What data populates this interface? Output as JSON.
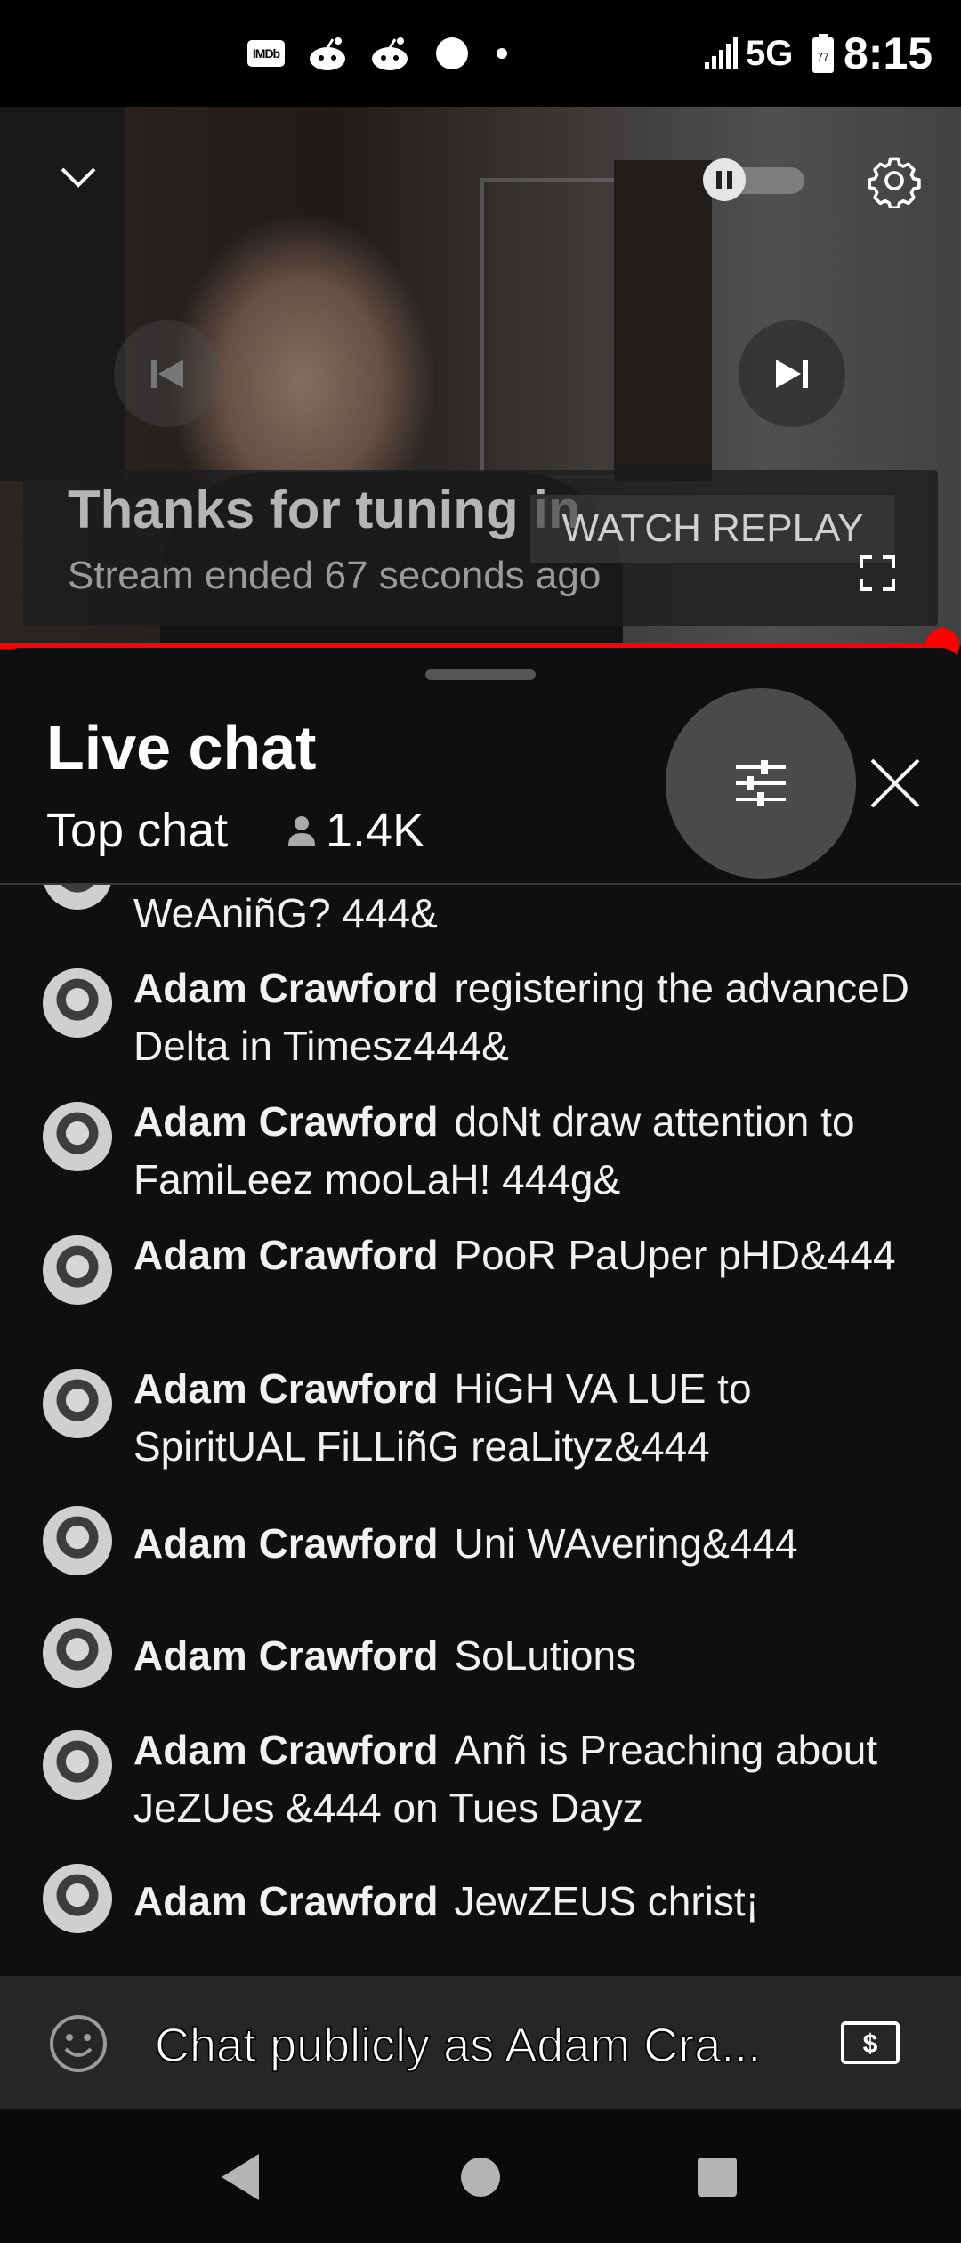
{
  "status_bar": {
    "app_icons": [
      "imdb-icon",
      "reddit-icon",
      "reddit-icon",
      "circle-dot-icon",
      "small-dot-icon"
    ],
    "imdb_label": "IMDb",
    "network": "5G",
    "battery_level": "77",
    "time": "8:15"
  },
  "player": {
    "ended_title": "Thanks for tuning in",
    "ended_subtitle": "Stream ended 67 seconds ago",
    "watch_replay_label": "WATCH REPLAY",
    "progress": 1.0
  },
  "chat": {
    "title": "Live chat",
    "mode": "Top chat",
    "viewer_count": "1.4K",
    "messages": [
      {
        "author": "",
        "text": "WeAniñG? 444&"
      },
      {
        "author": "Adam Crawford",
        "text": "registering the advanceD Delta in Timesz444&"
      },
      {
        "author": "Adam Crawford",
        "text": "doNt draw attention to FamiLeez mooLaH! 444g&"
      },
      {
        "author": "Adam Crawford",
        "text": "PooR PaUper pHD&444"
      },
      {
        "author": "Adam Crawford",
        "text": "HiGH VA LUE to SpiritUAL FiLLiñG reaLityz&444"
      },
      {
        "author": "Adam Crawford",
        "text": "Uni WAvering&444"
      },
      {
        "author": "Adam Crawford",
        "text": "SoLutions"
      },
      {
        "author": "Adam Crawford",
        "text": "Anñ is Preaching about JeZUes &444 on Tues Dayz"
      },
      {
        "author": "Adam Crawford",
        "text": "JewZEUS christ¡"
      }
    ],
    "input_placeholder": "Chat publicly as Adam Cra..."
  },
  "colors": {
    "accent": "#ff0000",
    "background": "#0f0f0f",
    "input_bar": "#262626"
  }
}
